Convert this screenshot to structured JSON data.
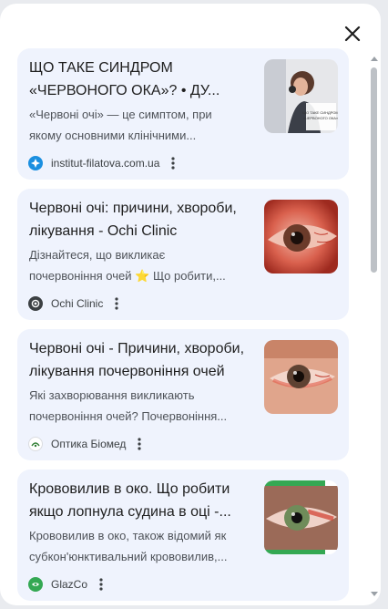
{
  "dialog": {
    "close_icon": "close-icon"
  },
  "results": [
    {
      "title_line1": "ЩО ТАКЕ СИНДРОМ",
      "title_line2": "«ЧЕРВОНОГО ОКА»? • ДУ...",
      "snippet_line1": "«Червоні очі» — це симптом, при",
      "snippet_line2": "якому основними клінічними...",
      "site": "institut-filatova.com.ua",
      "favicon_color": "#1a8fe0",
      "thumb_caption": "ЩО ТАКЕ СИНДРОМ «ЧЕРВОНОГО ОКА»"
    },
    {
      "title_line1": "Червоні очі: причини, хвороби,",
      "title_line2": "лікування - Ochi Clinic",
      "snippet_line1": "Дізнайтеся, що викликає",
      "snippet_line2a": "почервоніння очей",
      "snippet_star": "⭐",
      "snippet_line2b": "Що робити,...",
      "site": "Ochi Clinic",
      "favicon_color": "#3c4043"
    },
    {
      "title_line1": "Червоні очі - Причини, хвороби,",
      "title_line2": "лікування почервоніння очей",
      "snippet_line1": "Які захворювання викликають",
      "snippet_line2": "почервоніння очей? Почервоніння...",
      "site": "Оптика Біомед",
      "favicon_color": "#2e7d32"
    },
    {
      "title_line1": "Крововилив в око. Що робити",
      "title_line2": "якщо лопнула судина в оці -...",
      "snippet_line1": "Крововилив в око, також відомий як",
      "snippet_line2": "субкон'юнктивальний крововилив,...",
      "site": "GlazCo",
      "favicon_color": "#34a853"
    }
  ],
  "icons": {
    "more": "more-vert-icon"
  }
}
